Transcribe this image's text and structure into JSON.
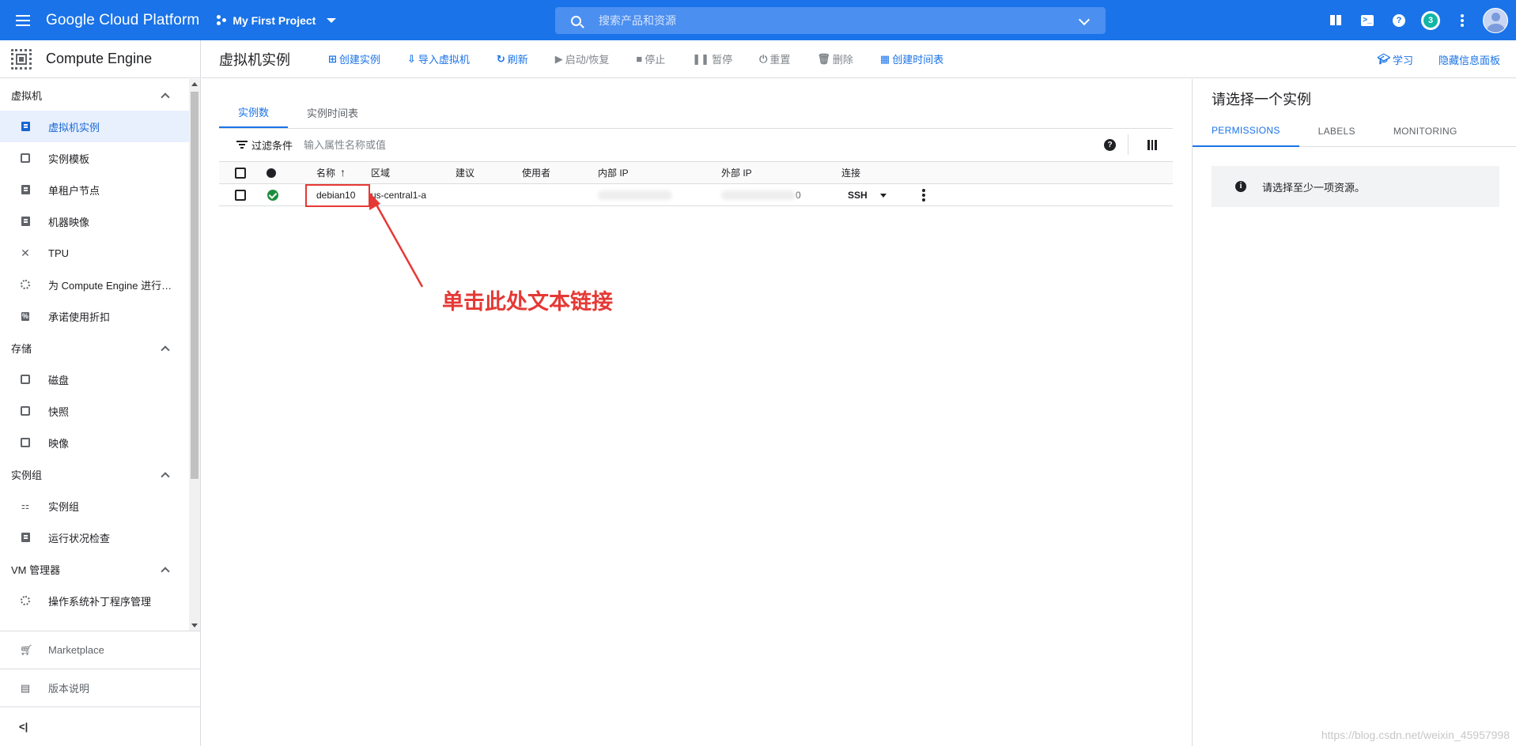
{
  "topbar": {
    "brand": "Google Cloud Platform",
    "project": "My First Project",
    "search_placeholder": "搜索产品和资源",
    "notification_count": "3"
  },
  "sidebar": {
    "product": "Compute Engine",
    "sections": [
      {
        "label": "虚拟机",
        "items": [
          {
            "label": "虚拟机实例",
            "icon": "vm-instance-icon",
            "active": true
          },
          {
            "label": "实例模板",
            "icon": "template-icon"
          },
          {
            "label": "单租户节点",
            "icon": "sole-tenant-icon"
          },
          {
            "label": "机器映像",
            "icon": "machine-image-icon"
          },
          {
            "label": "TPU",
            "icon": "tpu-icon"
          },
          {
            "label": "为 Compute Engine 进行…",
            "icon": "migrate-icon"
          },
          {
            "label": "承诺使用折扣",
            "icon": "percent-icon"
          }
        ]
      },
      {
        "label": "存储",
        "items": [
          {
            "label": "磁盘",
            "icon": "disk-icon"
          },
          {
            "label": "快照",
            "icon": "snapshot-icon"
          },
          {
            "label": "映像",
            "icon": "image-icon"
          }
        ]
      },
      {
        "label": "实例组",
        "items": [
          {
            "label": "实例组",
            "icon": "instance-group-icon"
          },
          {
            "label": "运行状况检查",
            "icon": "health-check-icon"
          }
        ]
      },
      {
        "label": "VM 管理器",
        "items": [
          {
            "label": "操作系统补丁程序管理",
            "icon": "patch-icon"
          }
        ]
      }
    ],
    "bottom": [
      {
        "label": "Marketplace",
        "icon": "cart-icon"
      },
      {
        "label": "版本说明",
        "icon": "release-notes-icon"
      }
    ],
    "collapse_glyph": "<|"
  },
  "toolbar": {
    "title": "虚拟机实例",
    "actions": [
      {
        "label": "创建实例",
        "icon": "add-box-icon",
        "enabled": true
      },
      {
        "label": "导入虚拟机",
        "icon": "import-icon",
        "enabled": true
      },
      {
        "label": "刷新",
        "icon": "refresh-icon",
        "enabled": true
      },
      {
        "label": "启动/恢复",
        "icon": "play-icon",
        "enabled": false
      },
      {
        "label": "停止",
        "icon": "stop-icon",
        "enabled": false
      },
      {
        "label": "暂停",
        "icon": "pause-icon",
        "enabled": false
      },
      {
        "label": "重置",
        "icon": "power-icon",
        "enabled": false
      },
      {
        "label": "删除",
        "icon": "trash-icon",
        "enabled": false
      },
      {
        "label": "创建时间表",
        "icon": "calendar-icon",
        "enabled": true
      }
    ],
    "learn": "学习",
    "hide_panel": "隐藏信息面板"
  },
  "main": {
    "tabs": [
      "实例数",
      "实例时间表"
    ],
    "filter_label": "过滤条件",
    "filter_placeholder": "输入属性名称或值",
    "columns": [
      "名称",
      "区域",
      "建议",
      "使用者",
      "内部 IP",
      "外部 IP",
      "连接"
    ],
    "rows": [
      {
        "name": "debian10",
        "zone": "us-central1-a",
        "recommendation": "",
        "in_use_by": "",
        "internal_ip_visible": "",
        "external_ip_visible": "0",
        "connect": "SSH",
        "status": "running"
      }
    ],
    "annotation": "单击此处文本链接"
  },
  "right_panel": {
    "title": "请选择一个实例",
    "tabs": [
      "PERMISSIONS",
      "LABELS",
      "MONITORING"
    ],
    "info": "请选择至少一项资源。"
  },
  "watermark": "https://blog.csdn.net/weixin_45957998",
  "colors": {
    "accent": "#1a73e8",
    "annotation": "#e53935",
    "status_ok": "#1e8e3e"
  }
}
